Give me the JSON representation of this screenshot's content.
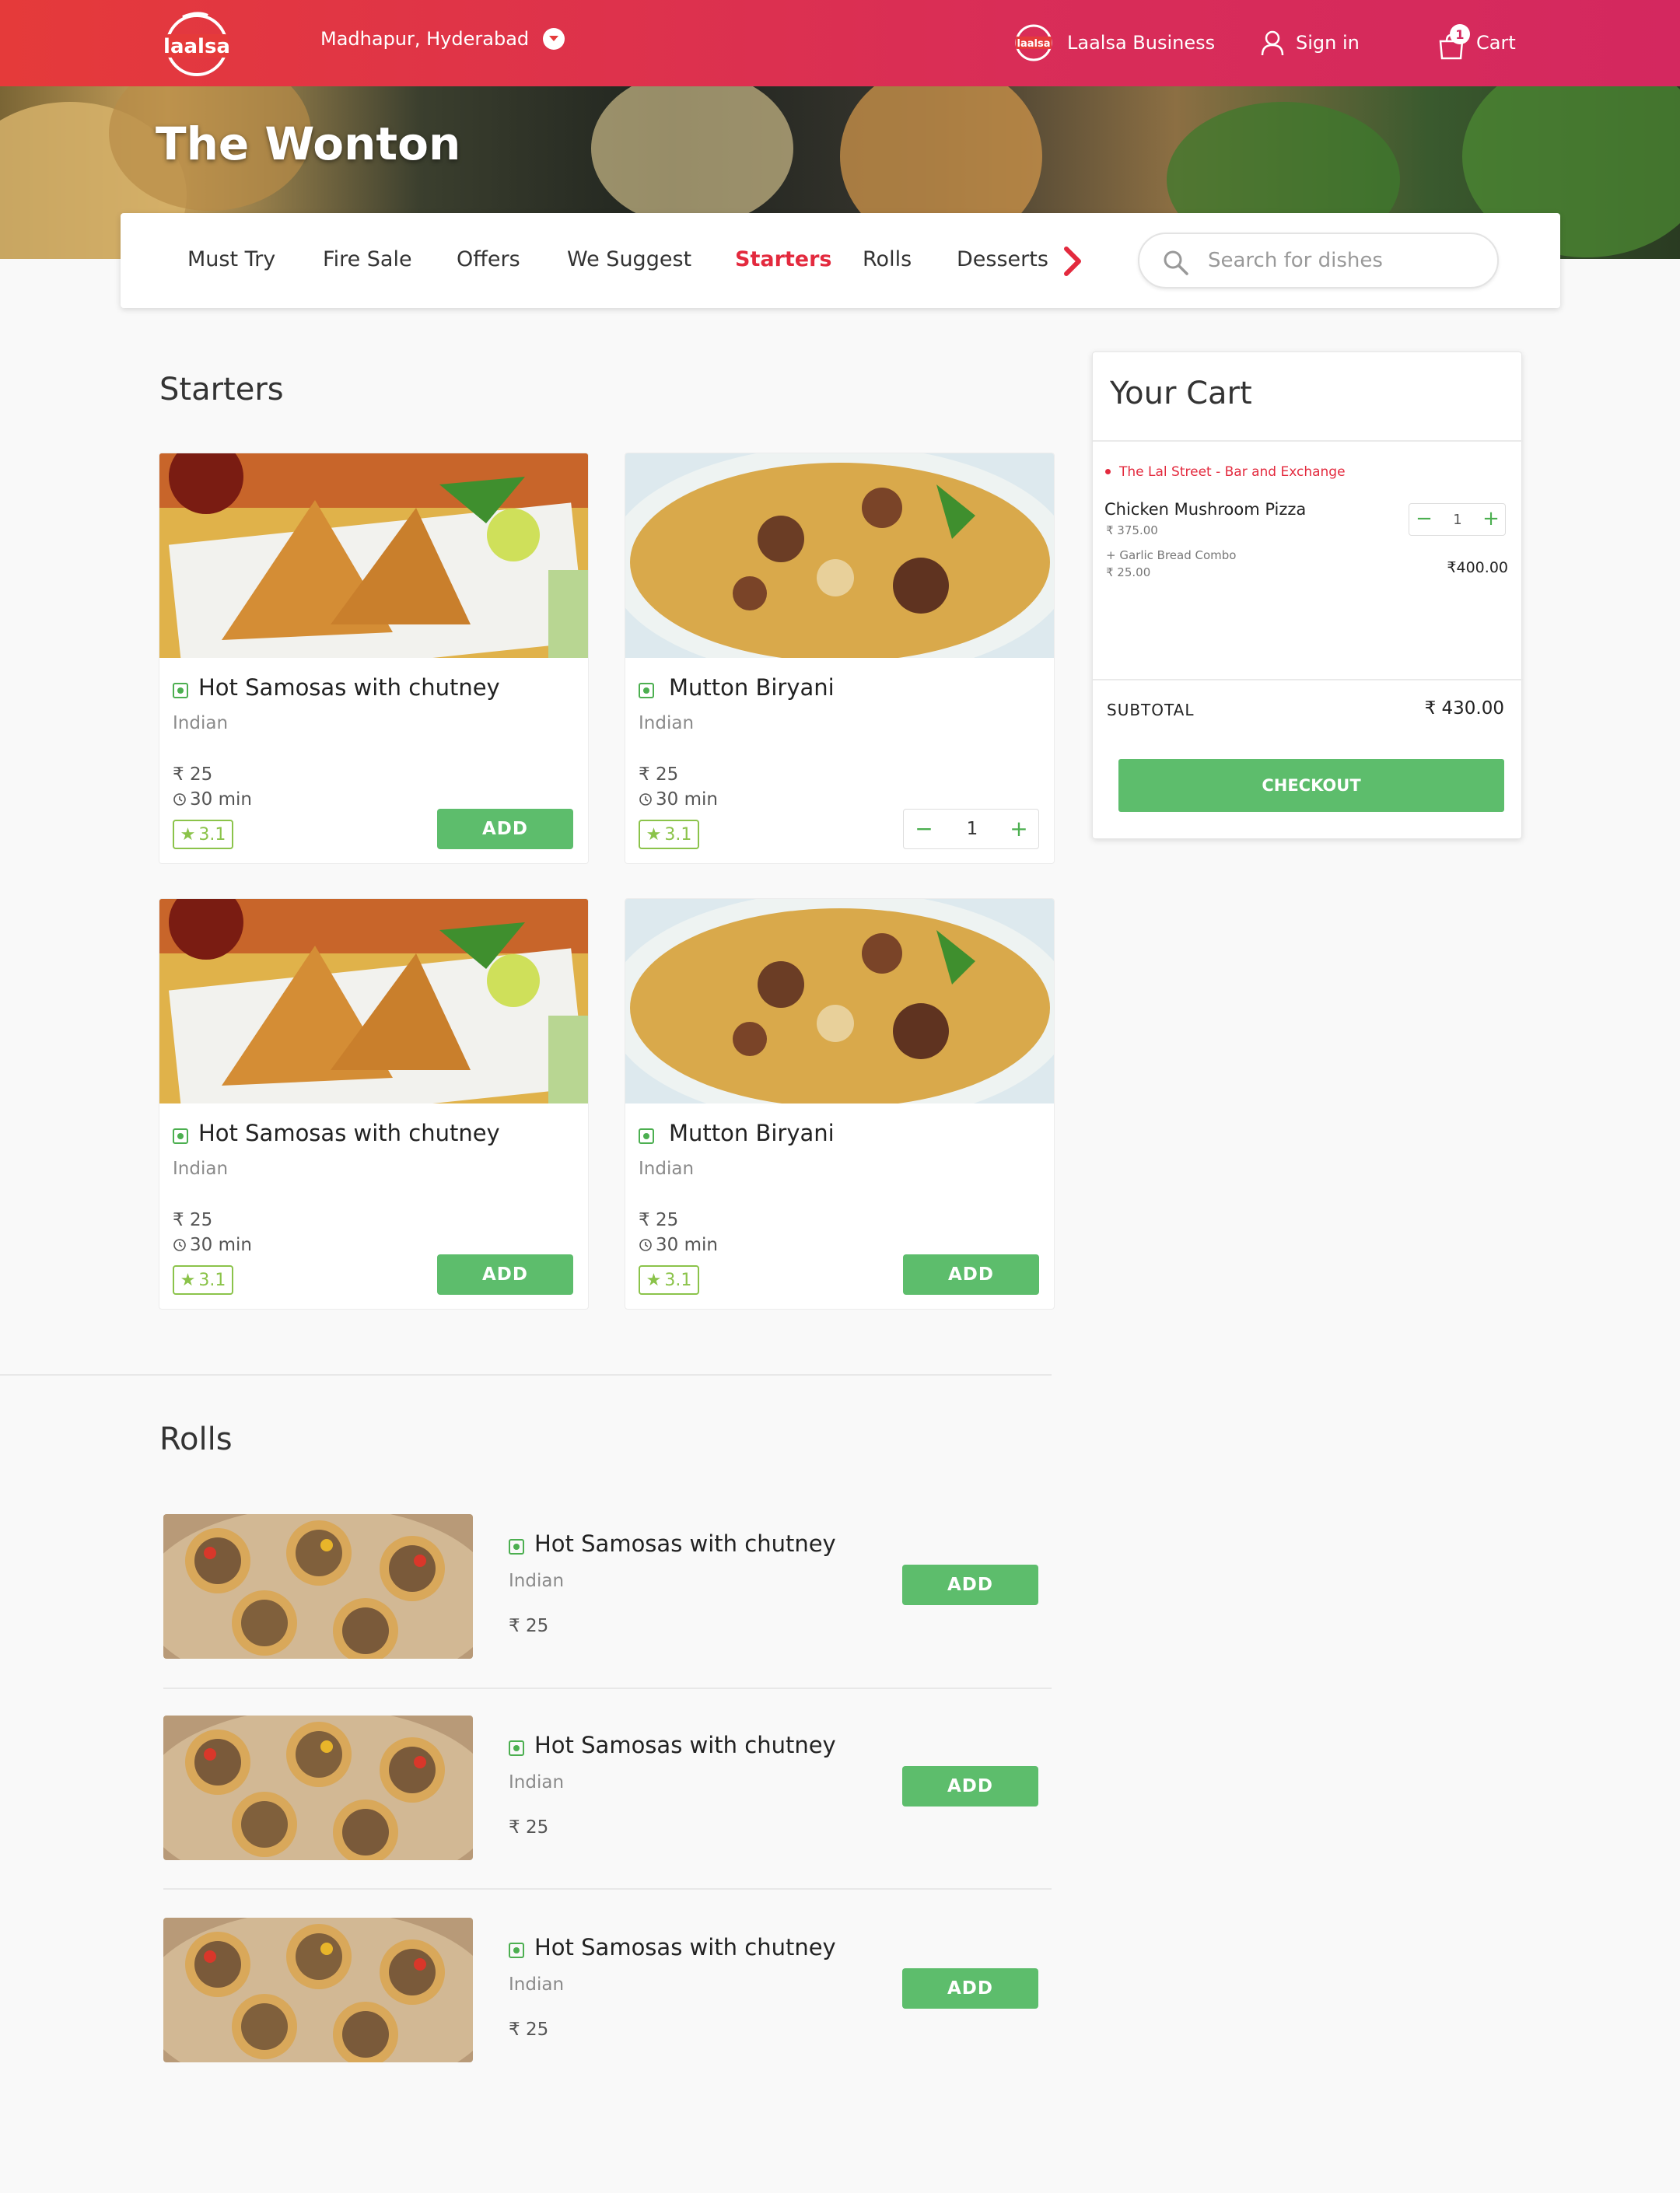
{
  "header": {
    "location": "Madhapur, Hyderabad",
    "business_label": "Laalsa Business",
    "signin_label": "Sign in",
    "cart_label": "Cart",
    "cart_count": "1",
    "brand_color": "#e53a3a"
  },
  "restaurant": {
    "name": "The Wonton"
  },
  "tabs": [
    {
      "label": "Must Try",
      "active": false
    },
    {
      "label": "Fire Sale",
      "active": false
    },
    {
      "label": "Offers",
      "active": false
    },
    {
      "label": "We Suggest",
      "active": false
    },
    {
      "label": "Starters",
      "active": true
    },
    {
      "label": "Rolls",
      "active": false
    },
    {
      "label": "Desserts",
      "active": false
    }
  ],
  "search": {
    "placeholder": "Search for dishes"
  },
  "starters": {
    "title": "Starters",
    "items": [
      {
        "name": "Hot Samosas with chutney",
        "cuisine": "Indian",
        "price": "25",
        "time": "30 min",
        "rating": "3.1",
        "action": "ADD"
      },
      {
        "name": "Mutton Biryani",
        "cuisine": "Indian",
        "price": "25",
        "time": "30 min",
        "rating": "3.1",
        "quantity": "1"
      },
      {
        "name": "Hot Samosas with chutney",
        "cuisine": "Indian",
        "price": "25",
        "time": "30 min",
        "rating": "3.1",
        "action": "ADD"
      },
      {
        "name": "Mutton Biryani",
        "cuisine": "Indian",
        "price": "25",
        "time": "30 min",
        "rating": "3.1",
        "action": "ADD"
      }
    ]
  },
  "rolls": {
    "title": "Rolls",
    "items": [
      {
        "name": "Hot Samosas with chutney",
        "cuisine": "Indian",
        "price": "25",
        "action": "ADD"
      },
      {
        "name": "Hot Samosas with chutney",
        "cuisine": "Indian",
        "price": "25",
        "action": "ADD"
      },
      {
        "name": "Hot Samosas with chutney",
        "cuisine": "Indian",
        "price": "25",
        "action": "ADD"
      }
    ]
  },
  "cart": {
    "title": "Your Cart",
    "restaurant": "The Lal Street - Bar and Exchange",
    "item_name": "Chicken Mushroom Pizza",
    "item_price": "₹ 375.00",
    "addon_name": "+ Garlic Bread Combo",
    "addon_price": "₹ 25.00",
    "quantity": "1",
    "line_total": "₹400.00",
    "subtotal_label": "SUBTOTAL",
    "subtotal_value": "₹  430.00",
    "checkout_label": "CHECKOUT"
  },
  "symbols": {
    "rupee": "₹",
    "star": "★",
    "minus": "−",
    "plus": "+"
  },
  "colors": {
    "accent_red": "#e32a3e",
    "add_green": "#5dbd6c",
    "rating_green": "#8bc34a"
  }
}
